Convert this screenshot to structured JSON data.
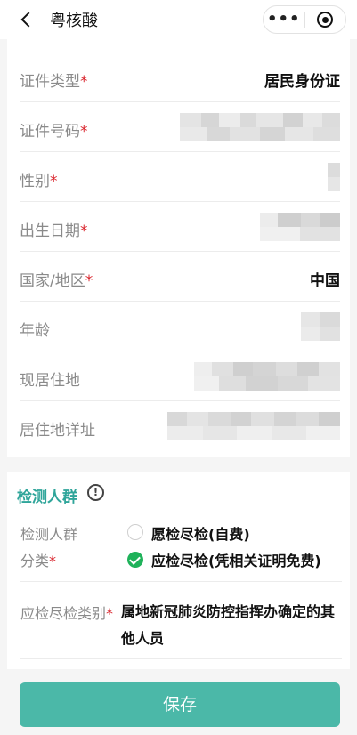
{
  "nav": {
    "title": "粤核酸",
    "more_label": "•••"
  },
  "form": {
    "rows": [
      {
        "label": "证件类型",
        "star": "*",
        "value": "居民身份证"
      },
      {
        "label": "证件号码",
        "star": "*",
        "value": ""
      },
      {
        "label": "性别",
        "star": "*",
        "value": ""
      },
      {
        "label": "出生日期",
        "star": "*",
        "value": ""
      },
      {
        "label": "国家/地区",
        "star": "*",
        "value": "中国"
      },
      {
        "label": "年龄",
        "star": "",
        "value": ""
      },
      {
        "label": "现居住地",
        "star": "",
        "value": ""
      },
      {
        "label": "居住地详址",
        "star": "",
        "value": ""
      }
    ]
  },
  "section": {
    "title": "检测人群",
    "info_icon": "!",
    "group_label_line1": "检测人群",
    "group_label_line2": "分类",
    "group_star": "*",
    "option_1": "愿检尽检(自费)",
    "option_2": "应检尽检(凭相关证明免费)",
    "category_label": "应检尽检类别",
    "category_star": "*",
    "category_value": "属地新冠肺炎防控指挥办确定的其他人员"
  },
  "save_label": "保存",
  "colors": {
    "accent": "#2fa59a",
    "button": "#4bb8a8",
    "required": "#d9222a",
    "checked": "#1fb25a"
  }
}
